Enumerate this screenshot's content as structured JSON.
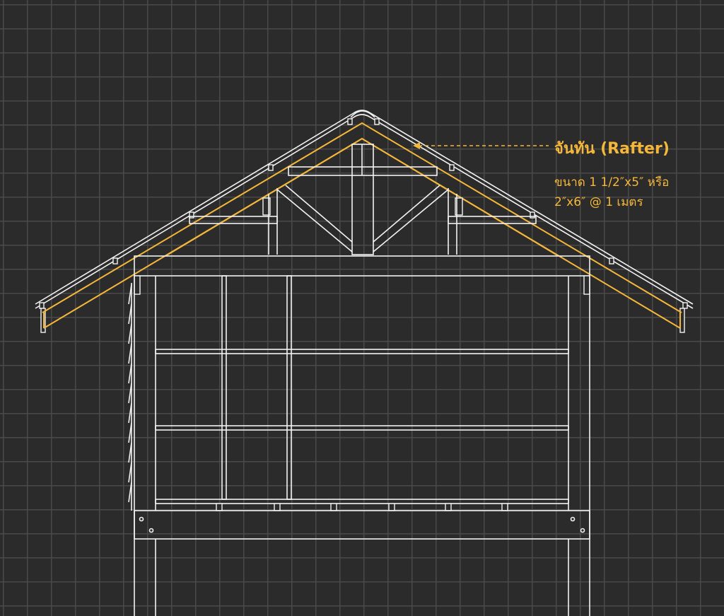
{
  "annotation": {
    "title": "จันทัน (Rafter)",
    "size_line1": "ขนาด 1 1/2″x5″ หรือ",
    "size_line2": "2″x6″  @ 1 เมตร"
  },
  "colors": {
    "background": "#2b2b2b",
    "grid": "#4a4a4a",
    "structure": "#f2f2f2",
    "highlight": "#f5b73a"
  }
}
